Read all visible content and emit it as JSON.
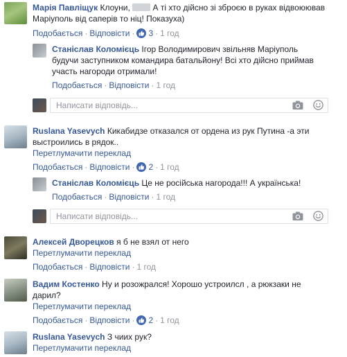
{
  "comments": [
    {
      "author": "Марія Павліщук",
      "text_1": "Клоуни,",
      "text_2": "А ті хто дійсно зі зброєю в руках відвоюював",
      "text_3": "Маріуполь від саперів то ніц! Показуха)",
      "like_label": "Подобається",
      "reply_label": "Відповісти",
      "likes": "3",
      "time": "1 год"
    },
    {
      "author": "Станіслав Коломієць",
      "text_1": "Ігор Володимирович звільняв Маріуполь",
      "text_2": "будучи заступником командира батальйону! Всі хто дійсно приймав",
      "text_3": "участь нагороди отримали!",
      "like_label": "Подобається",
      "reply_label": "Відповісти",
      "time": "1 год"
    },
    {
      "author": "Ruslana Yasevych",
      "text_1": "Кикабидзе отказался от ордена из рук Путина -а эти",
      "text_2": "выстроились в рядок..",
      "translate_label": "Перетлумачити переклад",
      "like_label": "Подобається",
      "reply_label": "Відповісти",
      "likes": "2",
      "time": "1 год"
    },
    {
      "author": "Станіслав Коломієць",
      "text_1": "Це не російська нагорода!!! А українська!",
      "like_label": "Подобається",
      "reply_label": "Відповісти",
      "time": "1 год"
    },
    {
      "author": "Алексей Дворецков",
      "text_1": "я б не взял от него",
      "translate_label": "Перетлумачити переклад",
      "like_label": "Подобається",
      "reply_label": "Відповісти",
      "time": "1 год"
    },
    {
      "author": "Вадим Костенко",
      "text_1": "Ну и розожрался! Хорошо устроилсл , а рюкзаки не",
      "text_2": "дарил?",
      "translate_label": "Перетлумачити переклад",
      "like_label": "Подобається",
      "reply_label": "Відповісти",
      "likes": "2",
      "time": "1 год"
    },
    {
      "author": "Ruslana Yasevych",
      "text_1": "З чиих рук?",
      "translate_label": "Перетлумачити переклад"
    }
  ],
  "reply_placeholder": "Написати відповідь...",
  "icons": {
    "like": "thumbs-up-icon",
    "camera": "camera-icon",
    "emoji": "smiley-icon"
  },
  "colors": {
    "link": "#365899",
    "meta": "#90949c",
    "like_badge": "#4267b2"
  }
}
